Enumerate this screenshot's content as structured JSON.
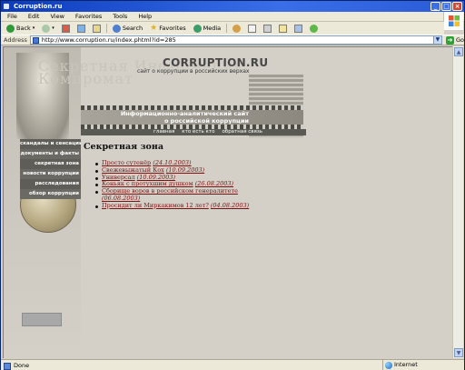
{
  "window": {
    "title": "Corruption.ru",
    "controls": {
      "minimize": "_",
      "maximize": "□",
      "close": "×"
    }
  },
  "menubar": {
    "items": [
      "File",
      "Edit",
      "View",
      "Favorites",
      "Tools",
      "Help"
    ]
  },
  "toolbar": {
    "back_label": "Back",
    "search_label": "Search",
    "favorites_label": "Favorites",
    "media_label": "Media"
  },
  "addressbar": {
    "label": "Address",
    "url": "http://www.corruption.ru/index.phtml?id=285",
    "go_label": "Go"
  },
  "page": {
    "logo": "CORRUPTION.RU",
    "slogan": "сайт о коррупции в российских верхах",
    "ghost_lines": [
      "Секретная Информация",
      "Компромат"
    ],
    "banner_text": [
      "Информационно-аналитический сайт",
      "о российской коррупции"
    ],
    "topnav": [
      "главная",
      "кто есть кто",
      "обратная связь"
    ],
    "sidenav": [
      "скандалы и сенсации",
      "документы и факты",
      "секретная зона",
      "новости коррупции",
      "расследования",
      "обзор коррупции"
    ],
    "section_title": "Секретная зона",
    "articles": [
      {
        "title": "Просто сутенёр",
        "date": "(24.10.2003)"
      },
      {
        "title": "Свежевыжатый Кох",
        "date": "(10.09.2003)"
      },
      {
        "title": "Универсал",
        "date": "(10.09.2003)"
      },
      {
        "title": "Коньяк с протухшим душком",
        "date": "(26.08.2003)"
      },
      {
        "title": "Сборище воров в российском генералитете",
        "date": "(06.08.2003)"
      },
      {
        "title": "Просидит ли Миркакимов 12 лет?",
        "date": "(04.08.2003)"
      }
    ]
  },
  "status": {
    "left": "Done",
    "zone": "Internet"
  }
}
